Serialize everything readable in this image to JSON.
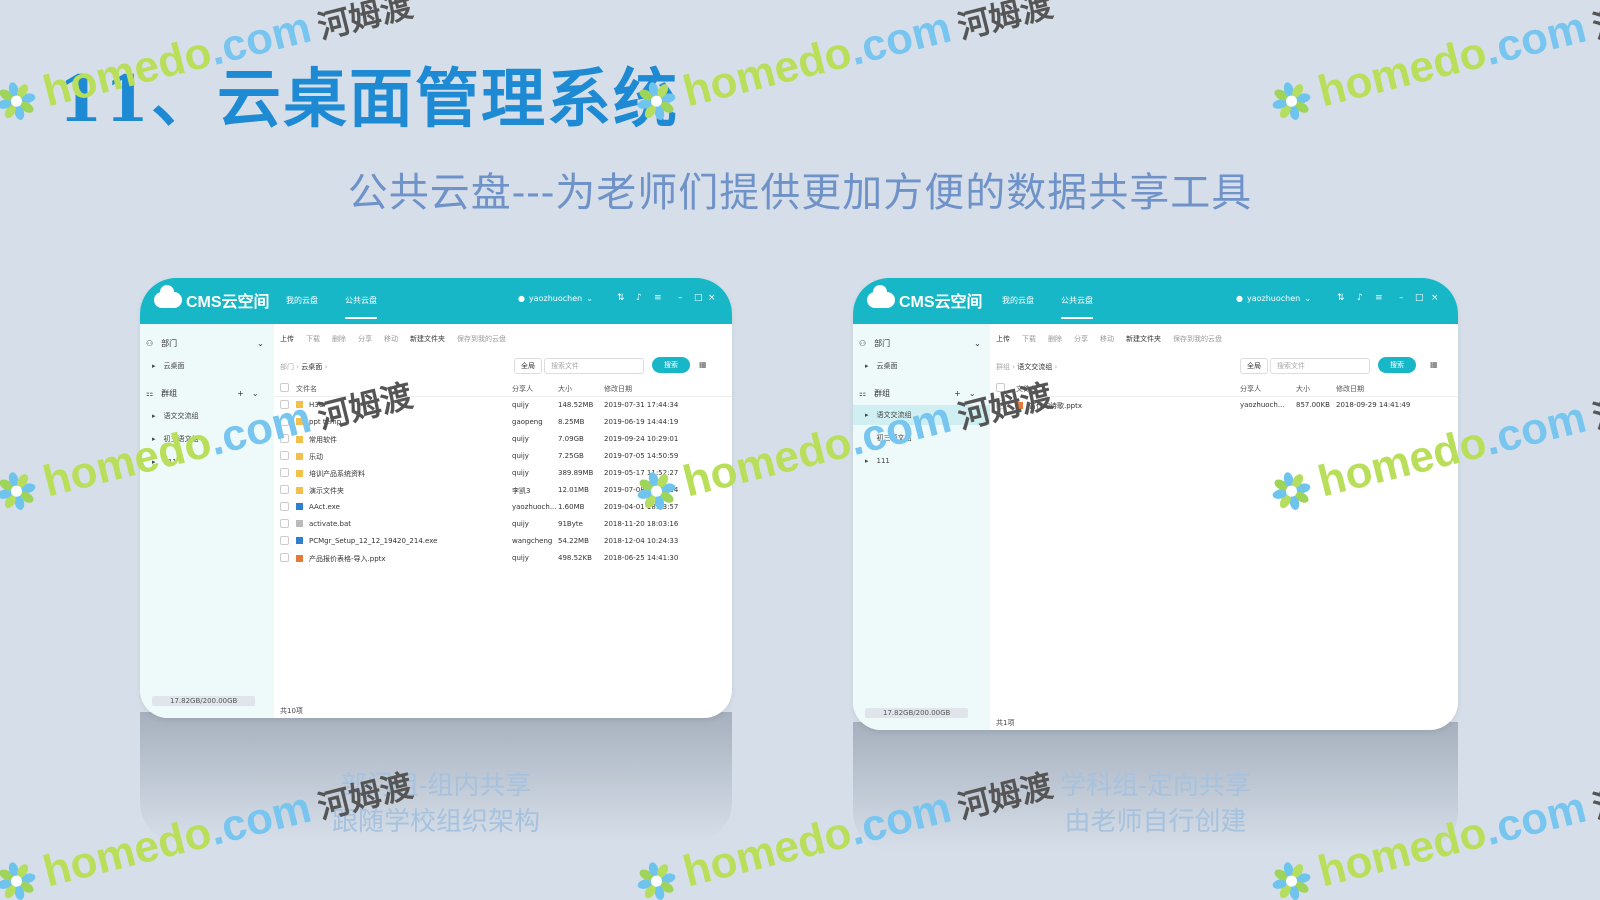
{
  "slide": {
    "title": "11、云桌面管理系统",
    "subtitle": "公共云盘---为老师们提供更加方便的数据共享工具"
  },
  "left_window": {
    "brand": "CMS云空间",
    "nav": [
      "我的云盘",
      "公共云盘"
    ],
    "user": "yaozhuochen",
    "sidebar": {
      "dept_label": "部门",
      "dept_items": [
        "云桌面"
      ],
      "group_label": "群组",
      "group_items": [
        "语文交流组",
        "初三语文组",
        "111"
      ],
      "storage": "17.82GB/200.00GB"
    },
    "toolbar": [
      "上传",
      "下载",
      "删除",
      "分享",
      "移动",
      "新建文件夹",
      "保存到我的云盘"
    ],
    "breadcrumb": {
      "root": "部门",
      "current": "云桌面"
    },
    "scope": "全局",
    "search_placeholder": "搜索文件",
    "search_button": "搜索",
    "columns": [
      "文件名",
      "分享人",
      "大小",
      "修改日期"
    ],
    "rows": [
      {
        "type": "folder",
        "name": "H3C",
        "sharer": "quijy",
        "size": "148.52MB",
        "date": "2019-07-31 17:44:34"
      },
      {
        "type": "folder",
        "name": "ppt temp",
        "sharer": "gaopeng",
        "size": "8.25MB",
        "date": "2019-06-19 14:44:19"
      },
      {
        "type": "folder",
        "name": "常用软件",
        "sharer": "quijy",
        "size": "7.09GB",
        "date": "2019-09-24 10:29:01"
      },
      {
        "type": "folder",
        "name": "乐动",
        "sharer": "quijy",
        "size": "7.25GB",
        "date": "2019-07-05 14:50:59"
      },
      {
        "type": "folder",
        "name": "培训产品系统资料",
        "sharer": "quijy",
        "size": "389.89MB",
        "date": "2019-05-17 11:52:27"
      },
      {
        "type": "folder",
        "name": "演示文件夹",
        "sharer": "李凯3",
        "size": "12.01MB",
        "date": "2019-07-08 16:09:14"
      },
      {
        "type": "exe",
        "name": "AAct.exe",
        "sharer": "yaozhuoch...",
        "size": "1.60MB",
        "date": "2019-04-01 18:23:57"
      },
      {
        "type": "bat",
        "name": "activate.bat",
        "sharer": "quijy",
        "size": "91Byte",
        "date": "2018-11-20 18:03:16"
      },
      {
        "type": "exe",
        "name": "PCMgr_Setup_12_12_19420_214.exe",
        "sharer": "wangcheng",
        "size": "54.22MB",
        "date": "2018-12-04 10:24:33"
      },
      {
        "type": "ppt",
        "name": "产品报价表格-导入.pptx",
        "sharer": "quijy",
        "size": "498.52KB",
        "date": "2018-06-25 14:41:30"
      }
    ],
    "status": "共10项"
  },
  "right_window": {
    "brand": "CMS云空间",
    "nav": [
      "我的云盘",
      "公共云盘"
    ],
    "user": "yaozhuochen",
    "sidebar": {
      "dept_label": "部门",
      "dept_items": [
        "云桌面"
      ],
      "group_label": "群组",
      "group_items": [
        "语文交流组",
        "初三语文组",
        "111"
      ],
      "storage": "17.82GB/200.00GB"
    },
    "toolbar": [
      "上传",
      "下载",
      "删除",
      "分享",
      "移动",
      "新建文件夹",
      "保存到我的云盘"
    ],
    "breadcrumb": {
      "root": "群组",
      "current": "语文交流组"
    },
    "scope": "全局",
    "search_placeholder": "搜索文件",
    "search_button": "搜索",
    "columns": [
      "文件名",
      "分享人",
      "大小",
      "修改日期"
    ],
    "rows": [
      {
        "type": "ppt",
        "name": "古代的诗歌.pptx",
        "sharer": "yaozhuoch...",
        "size": "857.00KB",
        "date": "2018-09-29 14:41:49"
      }
    ],
    "status": "共1项"
  },
  "captions": {
    "left": [
      "部门组-组内共享",
      "跟随学校组织架构"
    ],
    "right": [
      "学科组-定向共享",
      "由老师自行创建"
    ]
  },
  "watermark": {
    "latin_1": "homedo",
    "latin_2": ".com",
    "cn": "河姆渡"
  },
  "colors": {
    "accent": "#17b7c7",
    "title": "#1d8ad3",
    "subtitle": "#6f92c8",
    "background": "#d6dfe9"
  }
}
